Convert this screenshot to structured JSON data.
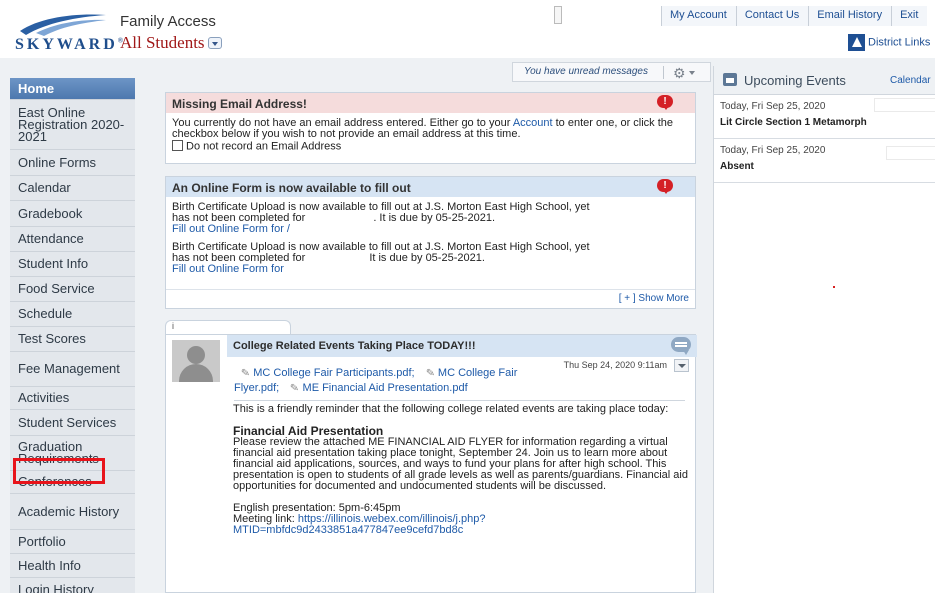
{
  "brand": {
    "logo_text": "SKYWARD",
    "reg_mark": "®",
    "colors": {
      "accent": "#1e4f93",
      "alert": "#d42026",
      "highlight": "#e8141b"
    }
  },
  "header": {
    "app_title": "Family Access",
    "student_selector": "All Students",
    "top_links": [
      "My Account",
      "Contact Us",
      "Email History",
      "Exit"
    ],
    "district_links": "District Links"
  },
  "sidebar": {
    "items": [
      {
        "label": "Home",
        "active": true
      },
      {
        "label": "East Online Registration 2020-2021"
      },
      {
        "label": "Online Forms"
      },
      {
        "label": "Calendar"
      },
      {
        "label": "Gradebook"
      },
      {
        "label": "Attendance"
      },
      {
        "label": "Student Info"
      },
      {
        "label": "Food Service"
      },
      {
        "label": "Schedule"
      },
      {
        "label": "Test Scores"
      },
      {
        "label": "Fee Management"
      },
      {
        "label": "Activities"
      },
      {
        "label": "Student Services"
      },
      {
        "label": "Graduation Requirements"
      },
      {
        "label": "Conferences",
        "highlighted": true
      },
      {
        "label": "Academic History"
      },
      {
        "label": "Portfolio"
      },
      {
        "label": "Health Info"
      },
      {
        "label": "Login History"
      }
    ]
  },
  "toolbar": {
    "unread_messages": "You have unread messages",
    "settings_icon": "gear-icon"
  },
  "messages": {
    "missing_email": {
      "title": "Missing Email Address!",
      "body_1": "You currently do not have an email address entered. Either go to your",
      "account_link": "Account",
      "body_2": "to enter one, or click the checkbox below if you wish to not provide an email address at this time.",
      "checkbox_label": "Do not record an Email Address"
    },
    "online_form": {
      "title": "An Online Form is now available to fill out",
      "item_1_line_1": "Birth Certificate Upload is now available to fill out at J.S. Morton East High School, yet",
      "item_1_line_2a": "has not been completed for",
      "item_1_line_2b": ". It is due by 05-25-2021.",
      "item_1_link": "Fill out Online Form for /",
      "item_2_line_1": "Birth Certificate Upload is now available to fill out at J.S. Morton East High School, yet",
      "item_2_line_2a": "has not been completed for",
      "item_2_line_2b": "It is due by 05-25-2021.",
      "item_2_link": "Fill out Online Form for",
      "show_more": "[ + ] Show More"
    }
  },
  "post": {
    "tab_label": "i",
    "title": "College Related Events Taking Place TODAY!!!",
    "timestamp": "Thu Sep 24, 2020 9:11am",
    "attachments": [
      "MC College Fair Participants.pdf;",
      "MC College Fair Flyer.pdf;",
      "ME Financial Aid Presentation.pdf"
    ],
    "intro": "This is a friendly reminder that the following college related events are taking place today:",
    "section_title": "Financial Aid Presentation",
    "section_body": "Please review the attached ME FINANCIAL AID FLYER for information regarding a virtual financial aid presentation taking place tonight, September 24. Join us to learn more about financial aid applications, sources, and ways to fund your plans for after high school. This presentation is open to students of all grade levels as well as parents/guardians. Financial aid opportunities for documented and undocumented students will be discussed.",
    "english_line": "English presentation: 5pm-6:45pm",
    "meeting_label": "Meeting link:",
    "meeting_link": "https://illinois.webex.com/illinois/j.php?MTID=mbfdc9d2433851a477847ee9cefd7bd8c"
  },
  "upcoming_events": {
    "title": "Upcoming Events",
    "calendar_link": "Calendar",
    "events": [
      {
        "date": "Today, Fri Sep 25, 2020",
        "title": "Lit Circle Section 1 Metamorph"
      },
      {
        "date": "Today, Fri Sep 25, 2020",
        "title": "Absent"
      }
    ]
  }
}
